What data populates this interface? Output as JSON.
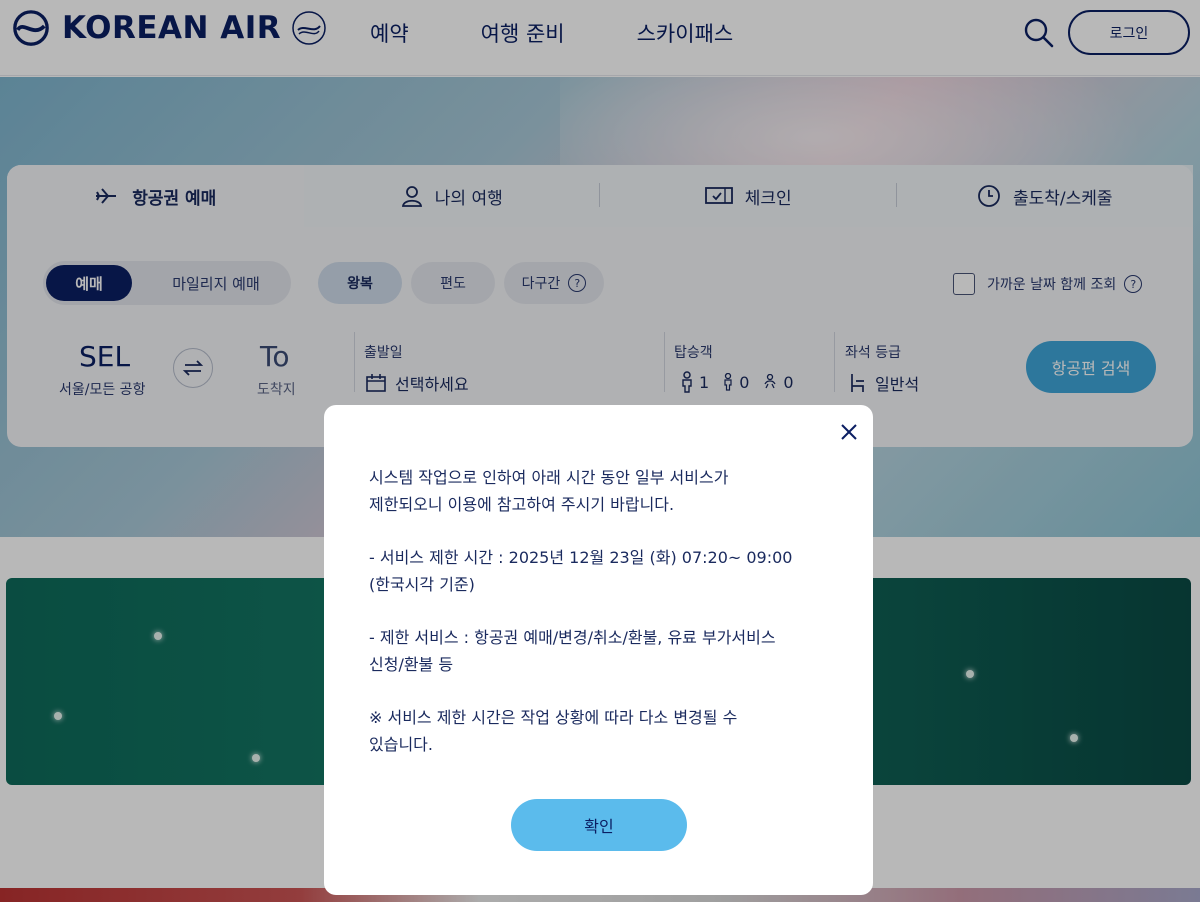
{
  "header": {
    "logo_text": "KOREAN AIR",
    "nav": [
      "예약",
      "여행 준비",
      "스카이패스"
    ],
    "login_label": "로그인"
  },
  "booking": {
    "tabs": [
      "항공권 예매",
      "나의 여행",
      "체크인",
      "출도착/스케줄"
    ],
    "mode": {
      "active": "예매",
      "inactive": "마일리지 예매"
    },
    "trip_types": [
      "왕복",
      "편도",
      "다구간"
    ],
    "nearby_dates_label": "가까운 날짜 함께 조회",
    "from": {
      "code": "SEL",
      "name": "서울/모든 공항"
    },
    "to": {
      "code": "To",
      "name": "도착지"
    },
    "departure": {
      "label": "출발일",
      "placeholder": "선택하세요"
    },
    "passengers": {
      "label": "탑승객",
      "adult": "1",
      "child": "0",
      "infant": "0"
    },
    "cabin": {
      "label": "좌석 등급",
      "value": "일반석"
    },
    "search_label": "항공편 검색"
  },
  "modal": {
    "lines": [
      "시스템 작업으로 인하여 아래 시간 동안 일부 서비스가",
      "제한되오니 이용에 참고하여 주시기 바랍니다.",
      "- 서비스 제한 시간 : 2025년 12월 23일 (화) 07:20~ 09:00",
      "(한국시각 기준)",
      "- 제한 서비스 : 항공권 예매/변경/취소/환불, 유료 부가서비스",
      "신청/환불 등",
      "※ 서비스 제한 시간은 작업 상황에 따라 다소 변경될 수",
      "있습니다."
    ],
    "confirm_label": "확인"
  },
  "colors": {
    "brand_navy": "#0b1f63",
    "accent_blue": "#3fa5d8",
    "confirm_blue": "#5bbbec"
  }
}
